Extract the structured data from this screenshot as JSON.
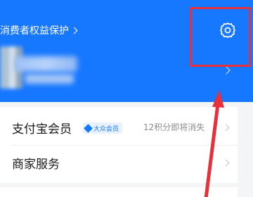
{
  "header": {
    "consumer_protection_label": "消费者权益保护",
    "background_color": "#1677ff",
    "settings_icon": "gear-icon",
    "highlight_color": "#e8303a"
  },
  "menu": {
    "membership": {
      "label": "支付宝会员",
      "badge": "大众会员",
      "points_text": "12积分即将消失"
    },
    "merchant_services": {
      "label": "商家服务"
    }
  }
}
